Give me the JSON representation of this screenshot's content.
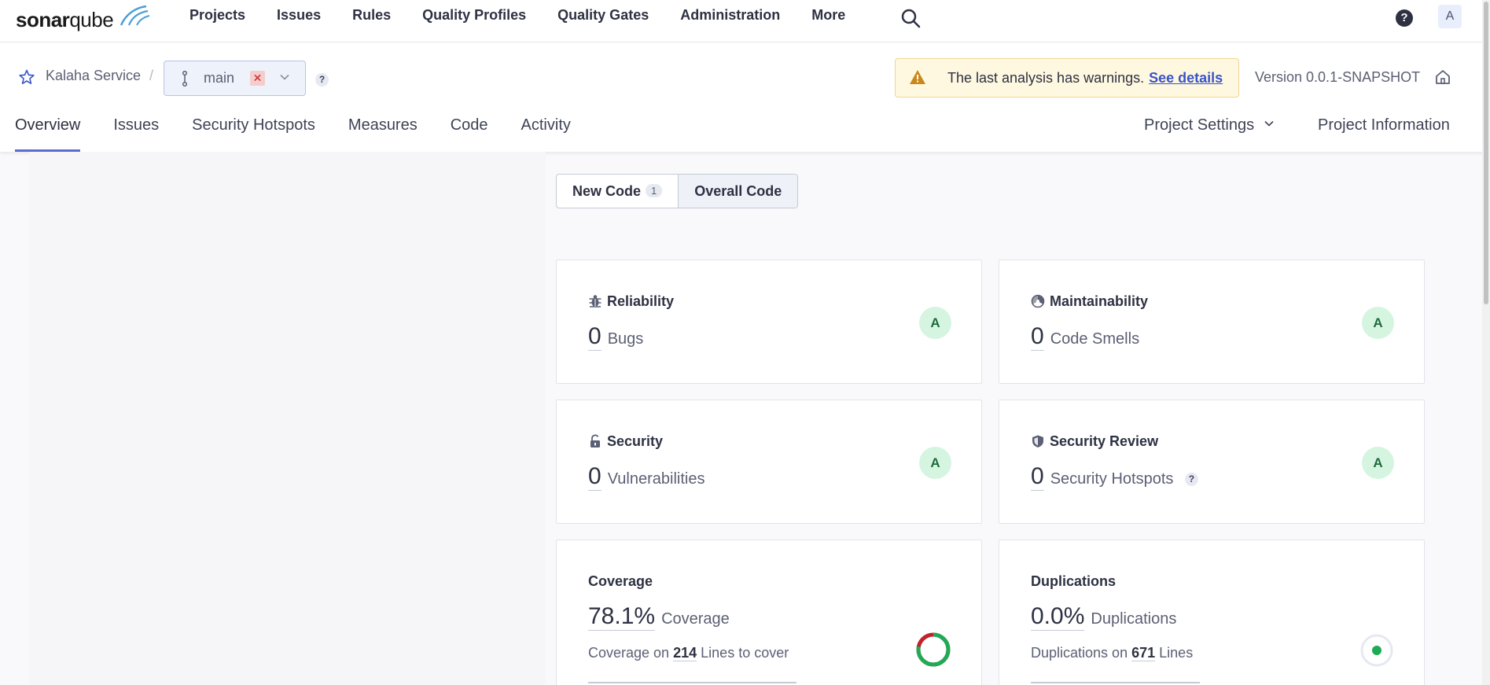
{
  "brand": {
    "logo_text_bold": "sonar",
    "logo_text_light": "qube"
  },
  "topnav": {
    "items": [
      "Projects",
      "Issues",
      "Rules",
      "Quality Profiles",
      "Quality Gates",
      "Administration",
      "More"
    ],
    "help_label": "?",
    "avatar_letter": "A"
  },
  "project": {
    "name": "Kalaha Service",
    "separator": "/",
    "branch": "main",
    "branch_error": "✕",
    "help_label": "?",
    "warning_text": "The last analysis has warnings.",
    "warning_link": "See details",
    "version": "Version 0.0.1-SNAPSHOT"
  },
  "tabs": {
    "items": [
      "Overview",
      "Issues",
      "Security Hotspots",
      "Measures",
      "Code",
      "Activity"
    ],
    "active": "Overview",
    "project_settings": "Project Settings",
    "project_information": "Project Information"
  },
  "code_toggle": {
    "new_code": "New Code",
    "new_code_count": "1",
    "overall_code": "Overall Code",
    "selected": "Overall Code"
  },
  "cards": {
    "reliability": {
      "title": "Reliability",
      "value": "0",
      "label": "Bugs",
      "rating": "A"
    },
    "maintainability": {
      "title": "Maintainability",
      "value": "0",
      "label": "Code Smells",
      "rating": "A"
    },
    "security": {
      "title": "Security",
      "value": "0",
      "label": "Vulnerabilities",
      "rating": "A"
    },
    "security_review": {
      "title": "Security Review",
      "value": "0",
      "label": "Security Hotspots",
      "help": "?",
      "rating": "A"
    },
    "coverage": {
      "title": "Coverage",
      "value": "78.1%",
      "label": "Coverage",
      "sub_prefix": "Coverage on",
      "sub_num": "214",
      "sub_suffix": "Lines to cover",
      "percent": 78.1
    },
    "duplications": {
      "title": "Duplications",
      "value": "0.0%",
      "label": "Duplications",
      "sub_prefix": "Duplications on",
      "sub_num": "671",
      "sub_suffix": "Lines",
      "percent": 0.0
    }
  },
  "colors": {
    "accent": "#5d6cd0",
    "rating_bg": "#d5f5e1",
    "coverage_good": "#1eab56",
    "coverage_bad": "#c0232a"
  }
}
